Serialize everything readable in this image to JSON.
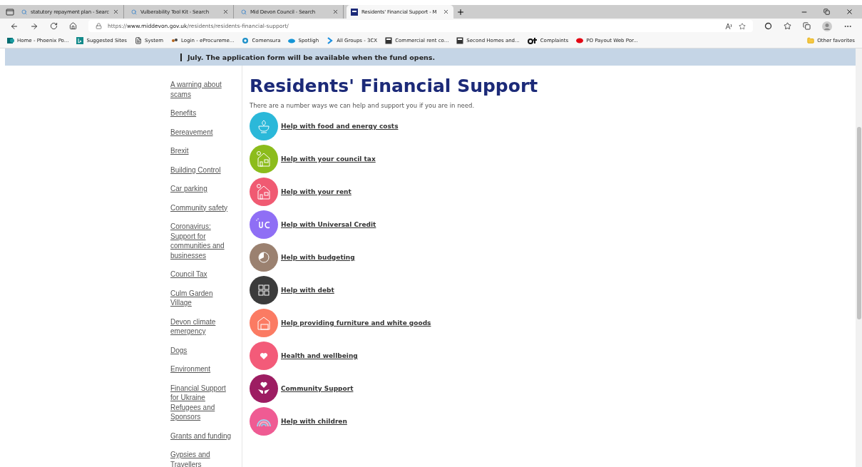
{
  "browser": {
    "tabs": [
      {
        "title": "statutory repayment plan - Searc",
        "selected": false
      },
      {
        "title": "Vulberability Tool Kit - Search",
        "selected": false
      },
      {
        "title": "Mid Devon Council - Search",
        "selected": false
      },
      {
        "title": "Residents' Financial Support - M",
        "selected": true
      }
    ],
    "address": {
      "scheme": "https://",
      "host": "www.middevon.gov.uk",
      "path": "/residents/residents-financial-support/"
    },
    "bookmarks": [
      {
        "label": "Home - Phoenix Po...",
        "kind": "sharepoint"
      },
      {
        "label": "Suggested Sites",
        "kind": "bing"
      },
      {
        "label": "System",
        "kind": "page"
      },
      {
        "label": "Login - eProcureme...",
        "kind": "eproc"
      },
      {
        "label": "Comensura",
        "kind": "ring"
      },
      {
        "label": "Spotligh",
        "kind": "cloud"
      },
      {
        "label": "All Groups - 3CX",
        "kind": "chevron"
      },
      {
        "label": "Commercial rent co...",
        "kind": "box"
      },
      {
        "label": "Second Homes and...",
        "kind": "box"
      },
      {
        "label": "Complaints",
        "kind": "ot"
      },
      {
        "label": "PO Payout Web Por...",
        "kind": "oval"
      }
    ],
    "other_favorites": "Other favorites"
  },
  "banner": {
    "text": "July. The application form will be available when the fund opens."
  },
  "sidebar": {
    "items": [
      "A warning about scams",
      "Benefits",
      "Bereavement",
      "Brexit",
      "Building Control",
      "Car parking",
      "Community safety",
      "Coronavirus: Support for communities and businesses",
      "Council Tax",
      "Culm Garden Village",
      "Devon climate emergency",
      "Dogs",
      "Environment",
      "Financial Support for Ukraine Refugees and Sponsors",
      "Grants and funding",
      "Gypsies and Travellers"
    ]
  },
  "main": {
    "title": "Residents' Financial Support",
    "intro": "There are a number ways we can help and support you if you are in need.",
    "links": [
      {
        "label": "Help with food and energy costs",
        "kind": "cup",
        "color": "#2bb8d9"
      },
      {
        "label": "Help with your council tax",
        "kind": "house",
        "color": "#8cbc1c"
      },
      {
        "label": "Help with your rent",
        "kind": "house",
        "color": "#f05a72"
      },
      {
        "label": "Help with Universal Credit",
        "kind": "uc",
        "color": "#8f6ff5"
      },
      {
        "label": "Help with budgeting",
        "kind": "pie",
        "color": "#9b8170"
      },
      {
        "label": "Help with debt",
        "kind": "grid",
        "color": "#3b3b3b"
      },
      {
        "label": "Help providing furniture and white goods",
        "kind": "furniture",
        "color": "#fb7b63"
      },
      {
        "label": "Health and wellbeing",
        "kind": "heart",
        "color": "#f35b79"
      },
      {
        "label": "Community Support",
        "kind": "hands",
        "color": "#9d1d62"
      },
      {
        "label": "Help with children",
        "kind": "rainbow",
        "color": "#ef5b93"
      }
    ]
  }
}
